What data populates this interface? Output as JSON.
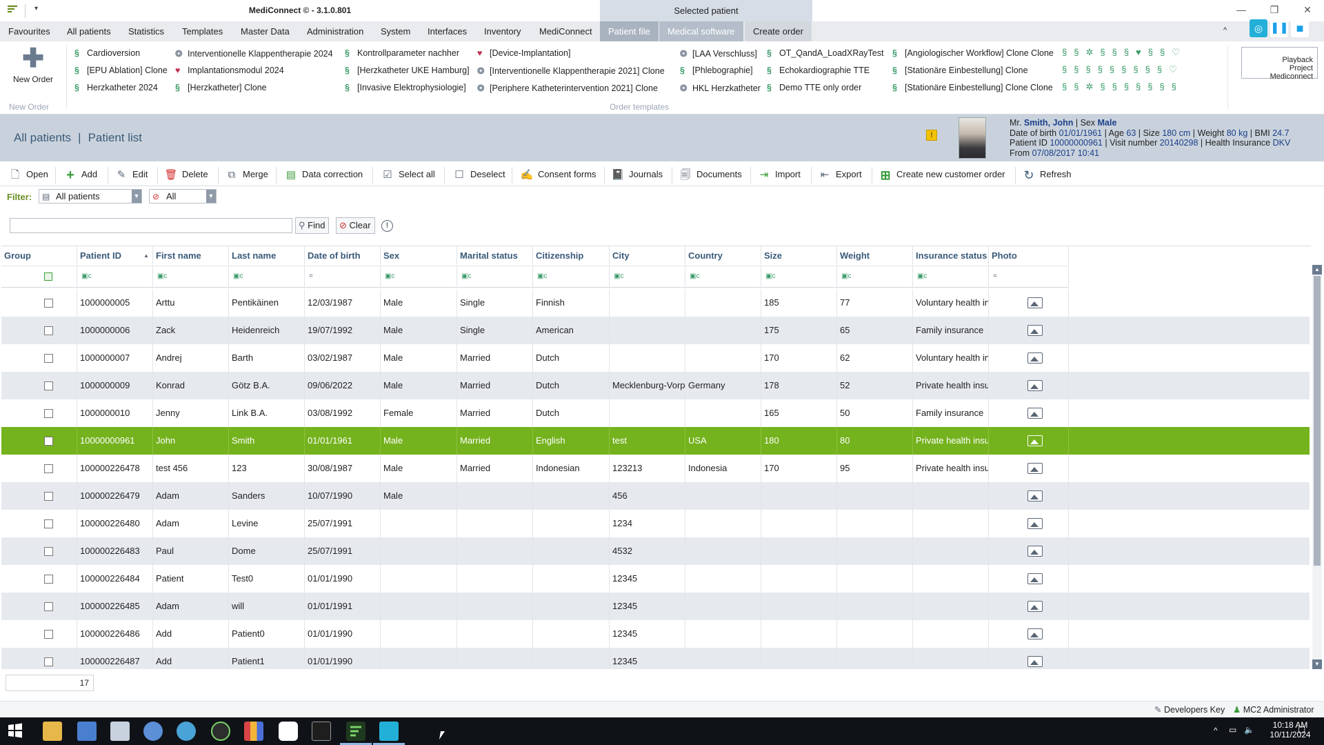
{
  "window": {
    "title": "MediConnect © - 3.1.0.801",
    "context_tab": "Selected patient"
  },
  "menu": {
    "items": [
      "Favourites",
      "All patients",
      "Statistics",
      "Templates",
      "Master Data",
      "Administration",
      "System",
      "Interfaces",
      "Inventory",
      "MediConnect"
    ],
    "context_items": [
      "Patient file",
      "Medical software",
      "Create order"
    ]
  },
  "ribbon": {
    "new_order_label": "New Order",
    "new_order_group": "New Order",
    "order_templates_group": "Order templates",
    "templates": [
      {
        "label": "Cardioversion",
        "icon": "green"
      },
      {
        "label": "[EPU Ablation] Clone",
        "icon": "green"
      },
      {
        "label": "Herzkatheter 2024",
        "icon": "green"
      },
      {
        "label": "Interventionelle Klappentherapie 2024",
        "icon": "grey"
      },
      {
        "label": "Implantationsmodul 2024",
        "icon": "heart"
      },
      {
        "label": "[Herzkatheter] Clone",
        "icon": "green"
      },
      {
        "label": "Kontrollparameter nachher",
        "icon": "green"
      },
      {
        "label": "[Herzkatheter UKE Hamburg]",
        "icon": "green"
      },
      {
        "label": "[Invasive Elektrophysiologie]",
        "icon": "green"
      },
      {
        "label": "[Device-Implantation]",
        "icon": "heart"
      },
      {
        "label": "[Interventionelle Klappentherapie 2021] Clone",
        "icon": "grey"
      },
      {
        "label": "[Periphere Katheterintervention 2021] Clone",
        "icon": "grey"
      },
      {
        "label": "[LAA Verschluss]",
        "icon": "grey"
      },
      {
        "label": "[Phlebographie]",
        "icon": "green"
      },
      {
        "label": "HKL Herzkatheter",
        "icon": "grey"
      },
      {
        "label": "OT_QandA_LoadXRayTest",
        "icon": "green"
      },
      {
        "label": "Echokardiographie TTE",
        "icon": "green"
      },
      {
        "label": "Demo TTE only order",
        "icon": "green"
      },
      {
        "label": "[Angiologischer Workflow] Clone Clone",
        "icon": "green"
      },
      {
        "label": "[Stationäre Einbestellung] Clone",
        "icon": "green"
      },
      {
        "label": "[Stationäre Einbestellung] Clone Clone",
        "icon": "green"
      }
    ],
    "playback_label": "Playback",
    "project_label": "Project Mediconnect"
  },
  "header": {
    "crumb_all": "All patients",
    "crumb_list": "Patient list",
    "patient": {
      "salutation": "Mr.",
      "name": "Smith, John",
      "sex_label": "Sex",
      "sex": "Male",
      "dob_label": "Date of birth",
      "dob": "01/01/1961",
      "age_label": "Age",
      "age": "63",
      "size_label": "Size",
      "size": "180 cm",
      "weight_label": "Weight",
      "weight": "80 kg",
      "bmi_label": "BMI",
      "bmi": "24.7",
      "pid_label": "Patient ID",
      "pid": "10000000961",
      "visit_label": "Visit number",
      "visit": "20140298",
      "ins_label": "Health Insurance",
      "ins": "DKV",
      "from_label": "From",
      "from": "07/08/2017 10:41"
    }
  },
  "toolbar": {
    "open": "Open",
    "add": "Add",
    "edit": "Edit",
    "delete": "Delete",
    "merge": "Merge",
    "data_correction": "Data correction",
    "select_all": "Select all",
    "deselect": "Deselect",
    "consent_forms": "Consent forms",
    "journals": "Journals",
    "documents": "Documents",
    "import": "Import",
    "export": "Export",
    "create_customer_order": "Create new customer order",
    "refresh": "Refresh"
  },
  "filter": {
    "label": "Filter:",
    "scope": "All patients",
    "status": "All"
  },
  "search": {
    "value": "",
    "find": "Find",
    "clear": "Clear"
  },
  "grid": {
    "columns": [
      "Group",
      "Patient ID",
      "First name",
      "Last name",
      "Date of birth",
      "Sex",
      "Marital status",
      "Citizenship",
      "City",
      "Country",
      "Size",
      "Weight",
      "Insurance status",
      "Photo"
    ],
    "rows": [
      [
        "",
        "1000000005",
        "Arttu",
        "Pentikäinen",
        "12/03/1987",
        "Male",
        "Single",
        "Finnish",
        "",
        "",
        "185",
        "77",
        "Voluntary health ins..."
      ],
      [
        "",
        "1000000006",
        "Zack",
        "Heidenreich",
        "19/07/1992",
        "Male",
        "Single",
        "American",
        "",
        "",
        "175",
        "65",
        "Family insurance"
      ],
      [
        "",
        "1000000007",
        "Andrej",
        "Barth",
        "03/02/1987",
        "Male",
        "Married",
        "Dutch",
        "",
        "",
        "170",
        "62",
        "Voluntary health ins..."
      ],
      [
        "",
        "1000000009",
        "Konrad",
        "Götz B.A.",
        "09/06/2022",
        "Male",
        "Married",
        "Dutch",
        "Mecklenburg-Vorpo...",
        "Germany",
        "178",
        "52",
        "Private health insur..."
      ],
      [
        "",
        "1000000010",
        "Jenny",
        "Link B.A.",
        "03/08/1992",
        "Female",
        "Married",
        "Dutch",
        "",
        "",
        "165",
        "50",
        "Family insurance"
      ],
      [
        "",
        "10000000961",
        "John",
        "Smith",
        "01/01/1961",
        "Male",
        "Married",
        "English",
        "test",
        "USA",
        "180",
        "80",
        "Private health insur..."
      ],
      [
        "",
        "100000226478",
        "test 456",
        "123",
        "30/08/1987",
        "Male",
        "Married",
        "Indonesian",
        "123213",
        "Indonesia",
        "170",
        "95",
        "Private health insur..."
      ],
      [
        "",
        "100000226479",
        "Adam",
        "Sanders",
        "10/07/1990",
        "Male",
        "",
        "",
        "456",
        "",
        "",
        "",
        ""
      ],
      [
        "",
        "100000226480",
        "Adam",
        "Levine",
        "25/07/1991",
        "",
        "",
        "",
        "1234",
        "",
        "",
        "",
        ""
      ],
      [
        "",
        "100000226483",
        "Paul",
        "Dome",
        "25/07/1991",
        "",
        "",
        "",
        "4532",
        "",
        "",
        "",
        ""
      ],
      [
        "",
        "100000226484",
        "Patient",
        "Test0",
        "01/01/1990",
        "",
        "",
        "",
        "12345",
        "",
        "",
        "",
        ""
      ],
      [
        "",
        "100000226485",
        "Adam",
        "will",
        "01/01/1991",
        "",
        "",
        "",
        "12345",
        "",
        "",
        "",
        ""
      ],
      [
        "",
        "100000226486",
        "Add",
        "Patient0",
        "01/01/1990",
        "",
        "",
        "",
        "12345",
        "",
        "",
        "",
        ""
      ],
      [
        "",
        "100000226487",
        "Add",
        "Patient1",
        "01/01/1990",
        "",
        "",
        "",
        "12345",
        "",
        "",
        "",
        ""
      ]
    ],
    "selected_row_index": 5,
    "record_count": "17"
  },
  "status": {
    "developers_key": "Developers Key",
    "user": "MC2 Administrator"
  },
  "taskbar": {
    "time": "10:18 AM",
    "date": "10/11/2024"
  },
  "colors": {
    "selected_row": "#74b21e",
    "header_text": "#3a5a78",
    "accent_blue": "#1aa0e8"
  }
}
